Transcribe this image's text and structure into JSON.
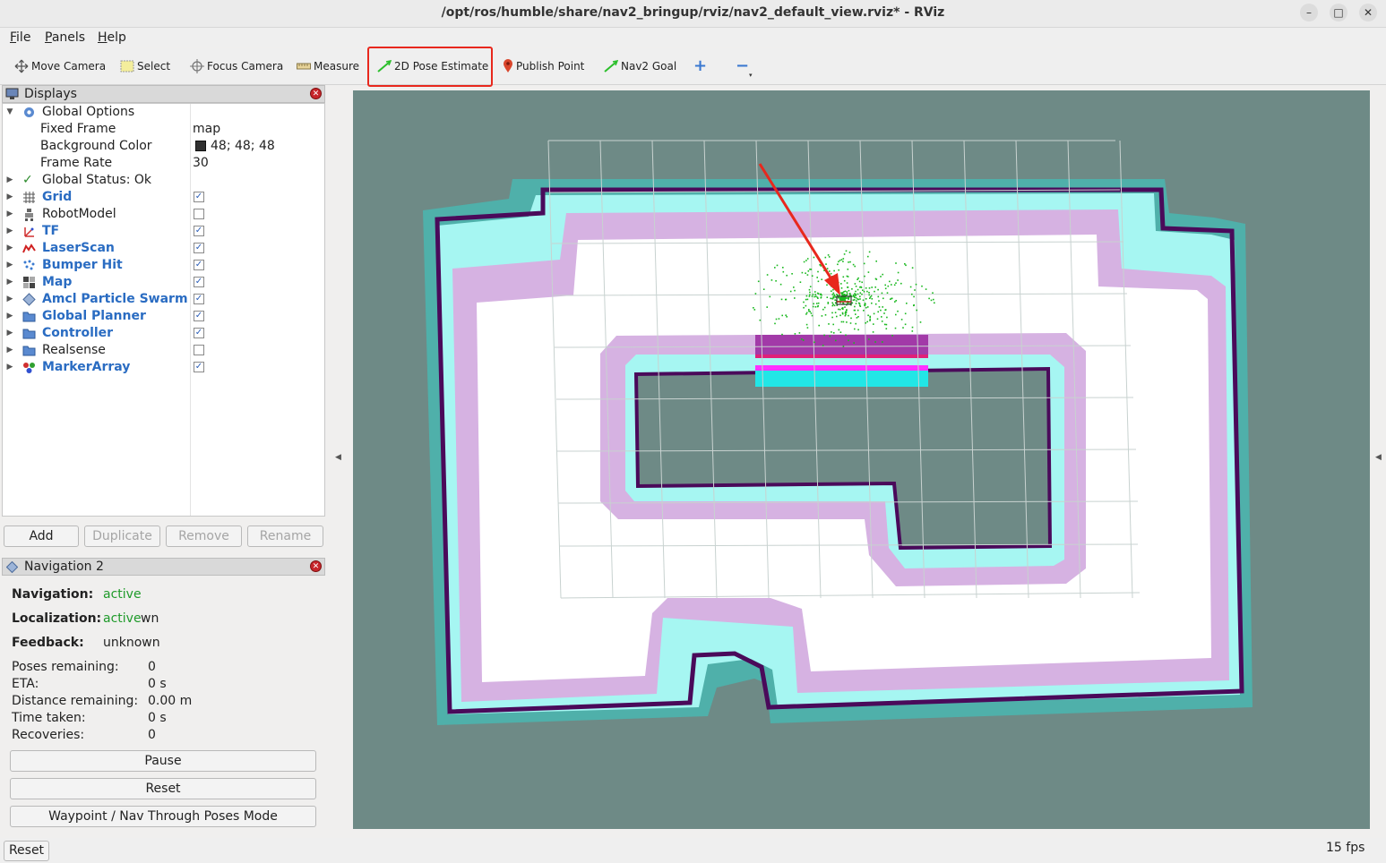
{
  "window": {
    "title": "/opt/ros/humble/share/nav2_bringup/rviz/nav2_default_view.rviz* - RViz",
    "minimize": "–",
    "maximize": "□",
    "close": "✕"
  },
  "menu": {
    "file": "File",
    "panels": "Panels",
    "help": "Help"
  },
  "toolbar": {
    "move_camera": "Move Camera",
    "select": "Select",
    "focus_camera": "Focus Camera",
    "measure": "Measure",
    "pose_estimate": "2D Pose Estimate",
    "publish_point": "Publish Point",
    "nav2_goal": "Nav2 Goal",
    "add_tool": "+",
    "remove_tool": "−"
  },
  "displays": {
    "title": "Displays",
    "global_options": "Global Options",
    "fixed_frame_label": "Fixed Frame",
    "fixed_frame_value": "map",
    "background_color_label": "Background Color",
    "background_color_value": "48; 48; 48",
    "frame_rate_label": "Frame Rate",
    "frame_rate_value": "30",
    "global_status": "Global Status: Ok",
    "items": [
      {
        "label": "Grid",
        "checked": true,
        "icon": "grid-icon"
      },
      {
        "label": "RobotModel",
        "checked": false,
        "icon": "robot-icon"
      },
      {
        "label": "TF",
        "checked": true,
        "icon": "tf-icon"
      },
      {
        "label": "LaserScan",
        "checked": true,
        "icon": "laser-icon"
      },
      {
        "label": "Bumper Hit",
        "checked": true,
        "icon": "dots-icon"
      },
      {
        "label": "Map",
        "checked": true,
        "icon": "map-icon"
      },
      {
        "label": "Amcl Particle Swarm",
        "checked": true,
        "icon": "diamond-icon"
      },
      {
        "label": "Global Planner",
        "checked": true,
        "icon": "folder-icon"
      },
      {
        "label": "Controller",
        "checked": true,
        "icon": "folder-icon"
      },
      {
        "label": "Realsense",
        "checked": false,
        "icon": "folder-icon"
      },
      {
        "label": "MarkerArray",
        "checked": true,
        "icon": "marker-icon"
      }
    ],
    "buttons": {
      "add": "Add",
      "duplicate": "Duplicate",
      "remove": "Remove",
      "rename": "Rename"
    }
  },
  "navigation": {
    "title": "Navigation 2",
    "navigation_label": "Navigation:",
    "navigation_value": "active",
    "localization_label": "Localization:",
    "localization_value": "active",
    "localization_suffix": "wn",
    "feedback_label": "Feedback:",
    "feedback_value": "unknown",
    "stats": [
      {
        "label": "Poses remaining:",
        "value": "0"
      },
      {
        "label": "ETA:",
        "value": "0 s"
      },
      {
        "label": "Distance remaining:",
        "value": "0.00 m"
      },
      {
        "label": "Time taken:",
        "value": "0 s"
      },
      {
        "label": "Recoveries:",
        "value": "0"
      }
    ],
    "pause": "Pause",
    "reset": "Reset",
    "mode": "Waypoint / Nav Through Poses Mode"
  },
  "status": {
    "reset": "Reset",
    "fps": "15 fps"
  },
  "colors": {
    "viewport_bg": "#6e8a86",
    "free_space": "#ffffff",
    "wall": "#4a0a5a",
    "inflation_outer": "#4fb0aa",
    "inflation_mid": "#a6f6f2",
    "inflation_inner": "#e8b0d4",
    "particles": "#19b81f",
    "arrow": "#e8281d",
    "highlight": "#e8281d"
  }
}
